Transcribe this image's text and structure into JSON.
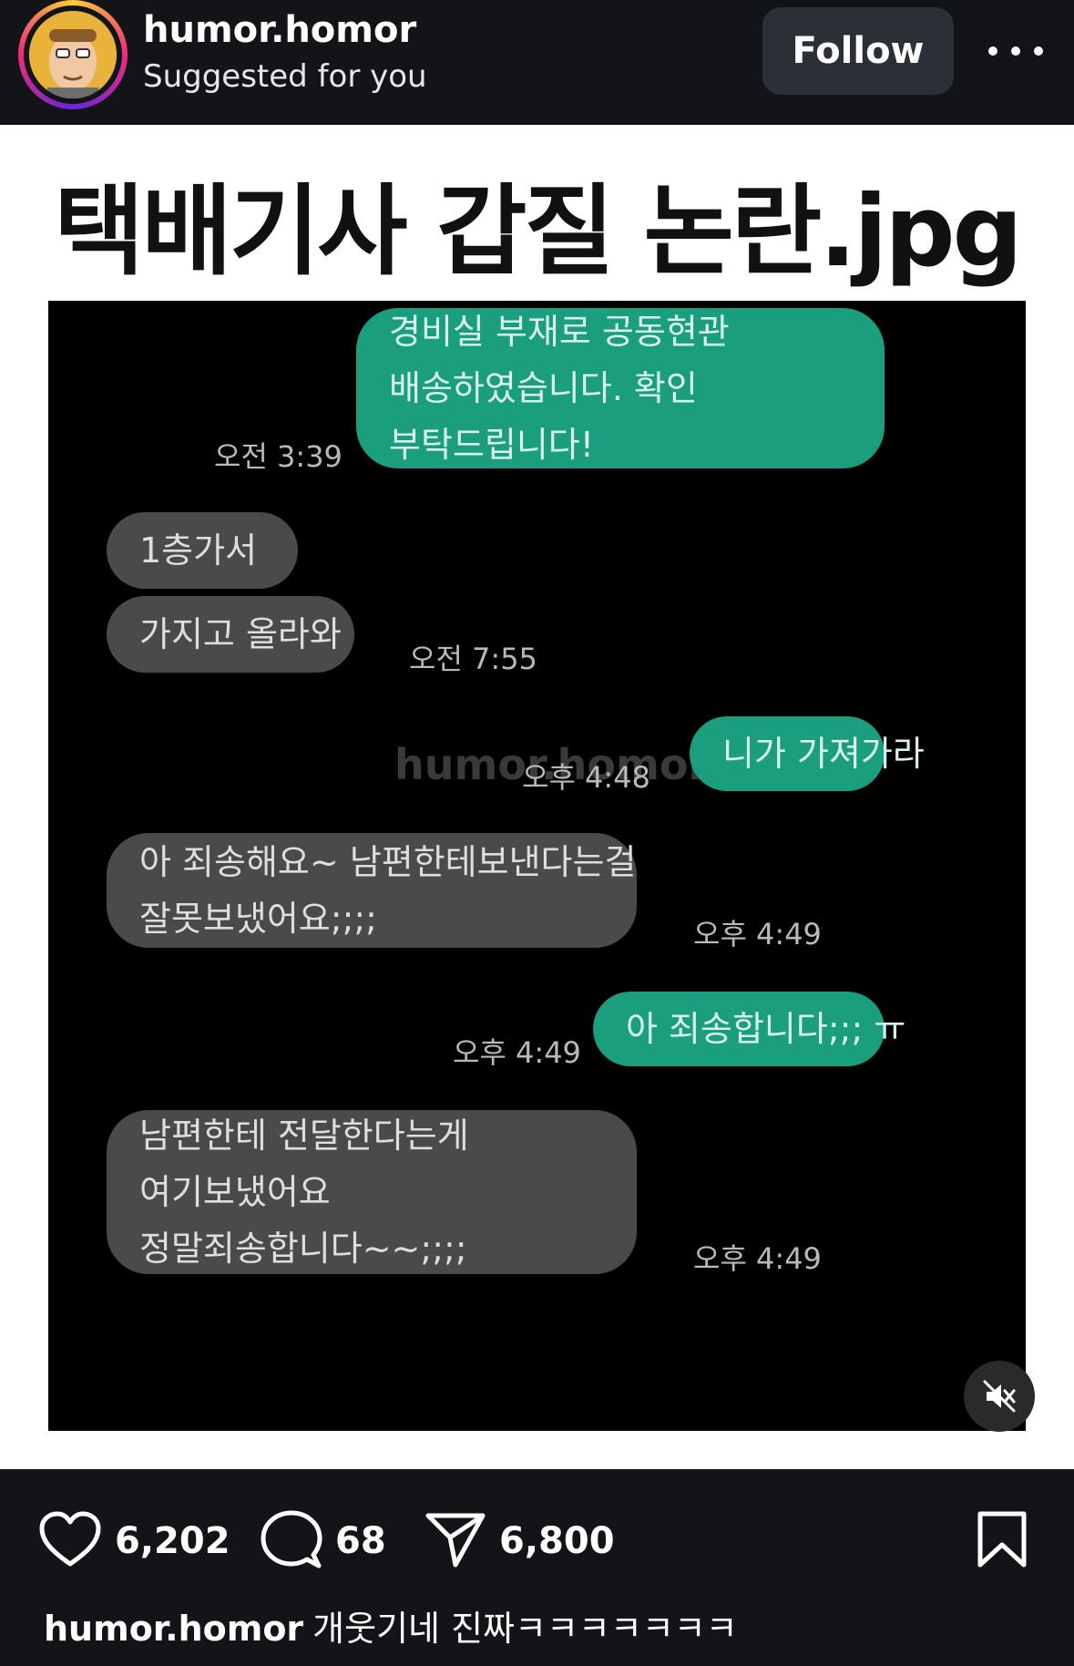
{
  "header": {
    "username": "humor.homor",
    "subtitle": "Suggested for you",
    "follow_label": "Follow"
  },
  "post": {
    "title": "택배기사 갑질 논란.jpg",
    "watermark": "humor.homor",
    "messages": [
      {
        "side": "out",
        "lines": [
          "경비실 부재로 공동현관",
          "배송하였습니다. 확인",
          "부탁드립니다!"
        ],
        "time": "오전 3:39"
      },
      {
        "side": "in",
        "lines": [
          "1층가서"
        ],
        "time": ""
      },
      {
        "side": "in",
        "lines": [
          "가지고 올라와"
        ],
        "time": "오전 7:55"
      },
      {
        "side": "out",
        "lines": [
          "니가 가져가라"
        ],
        "time": "오후 4:48"
      },
      {
        "side": "in",
        "lines": [
          "아 죄송해요~ 남편한테보낸다는걸",
          "잘못보냈어요;;;;"
        ],
        "time": "오후 4:49"
      },
      {
        "side": "out",
        "lines": [
          "아 죄송합니다;;; ㅠ"
        ],
        "time": "오후 4:49"
      },
      {
        "side": "in",
        "lines": [
          "남편한테 전달한다는게",
          "여기보냈어요",
          "정말죄송합니다~~;;;;"
        ],
        "time": "오후 4:49"
      }
    ]
  },
  "actions": {
    "likes": "6,202",
    "comments": "68",
    "shares": "6,800"
  },
  "caption": {
    "user": "humor.homor",
    "text": "개웃기네 진짜ㅋㅋㅋㅋㅋㅋㅋ"
  },
  "icons": {
    "like": "heart-icon",
    "comment": "comment-icon",
    "share": "share-icon",
    "save": "bookmark-icon",
    "mute": "muted-speaker-icon",
    "more": "more-icon"
  },
  "colors": {
    "outgoing_bubble": "#1a9e7d",
    "incoming_bubble": "#4a4a4a",
    "follow_button": "#2b2f36"
  }
}
